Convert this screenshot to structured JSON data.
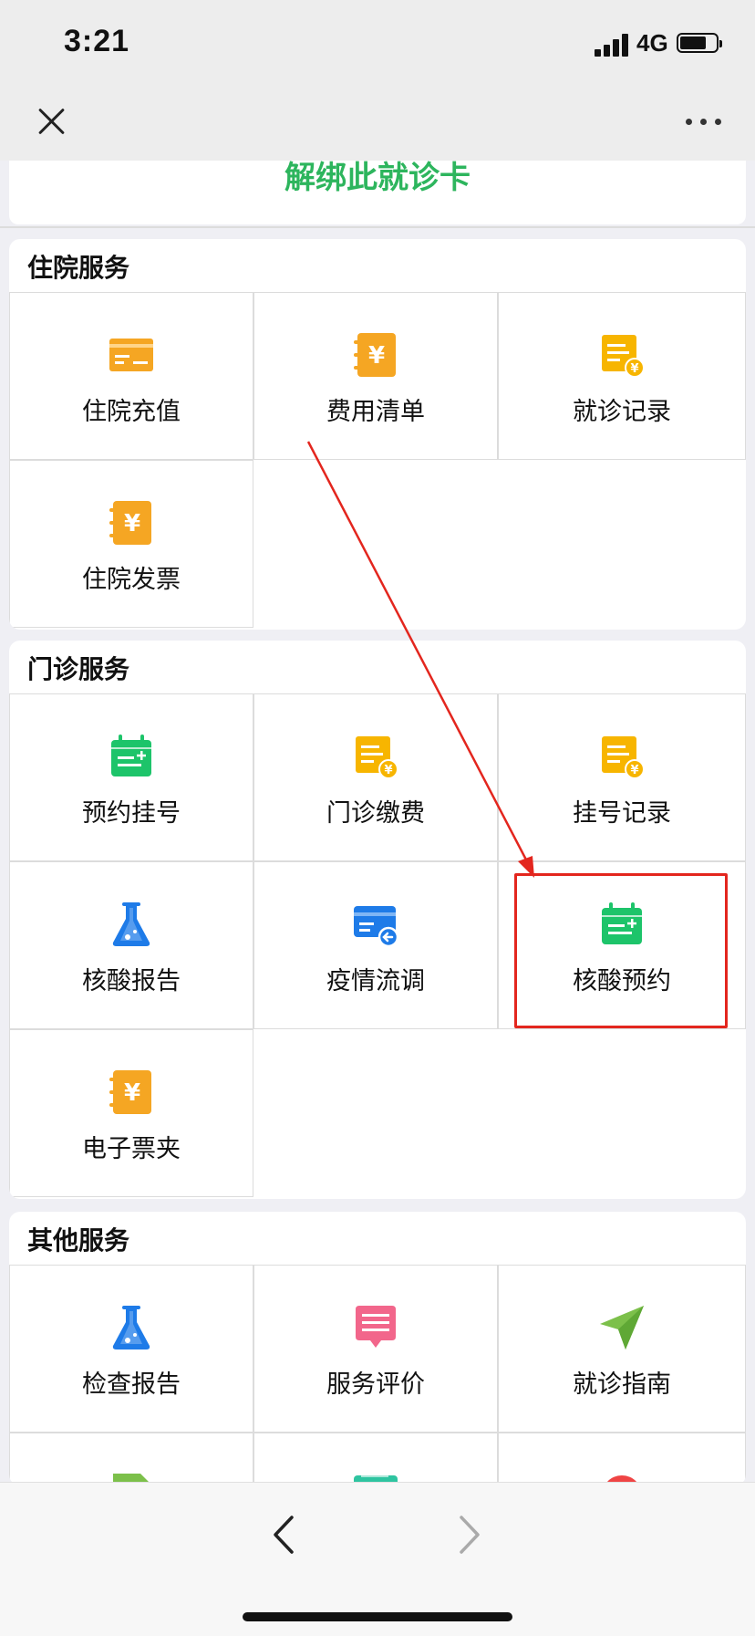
{
  "status_bar": {
    "time": "3:21",
    "network": "4G"
  },
  "unbind_label": "解绑此就诊卡",
  "sections": [
    {
      "title": "住院服务",
      "items": [
        {
          "label": "住院充值",
          "icon": "card-icon"
        },
        {
          "label": "费用清单",
          "icon": "yuan-notebook-icon"
        },
        {
          "label": "就诊记录",
          "icon": "document-yuan-icon"
        },
        {
          "label": "住院发票",
          "icon": "yuan-notebook-icon"
        }
      ]
    },
    {
      "title": "门诊服务",
      "items": [
        {
          "label": "预约挂号",
          "icon": "calendar-plus-icon"
        },
        {
          "label": "门诊缴费",
          "icon": "document-yuan-icon"
        },
        {
          "label": "挂号记录",
          "icon": "document-yuan-icon"
        },
        {
          "label": "核酸报告",
          "icon": "flask-icon"
        },
        {
          "label": "疫情流调",
          "icon": "card-arrow-icon"
        },
        {
          "label": "核酸预约",
          "icon": "calendar-plus-icon"
        },
        {
          "label": "电子票夹",
          "icon": "yuan-notebook-icon"
        }
      ]
    },
    {
      "title": "其他服务",
      "items": [
        {
          "label": "检查报告",
          "icon": "flask-icon"
        },
        {
          "label": "服务评价",
          "icon": "comment-icon"
        },
        {
          "label": "就诊指南",
          "icon": "navigation-arrow-icon"
        }
      ]
    }
  ],
  "colors": {
    "green_text": "#2db55d",
    "orange": "#f5a623",
    "yellow": "#f7b500",
    "green_icon": "#1dc46a",
    "blue": "#1e7be8",
    "pink": "#f2668b",
    "lime": "#7cc04a",
    "annotation_red": "#e3261e"
  }
}
